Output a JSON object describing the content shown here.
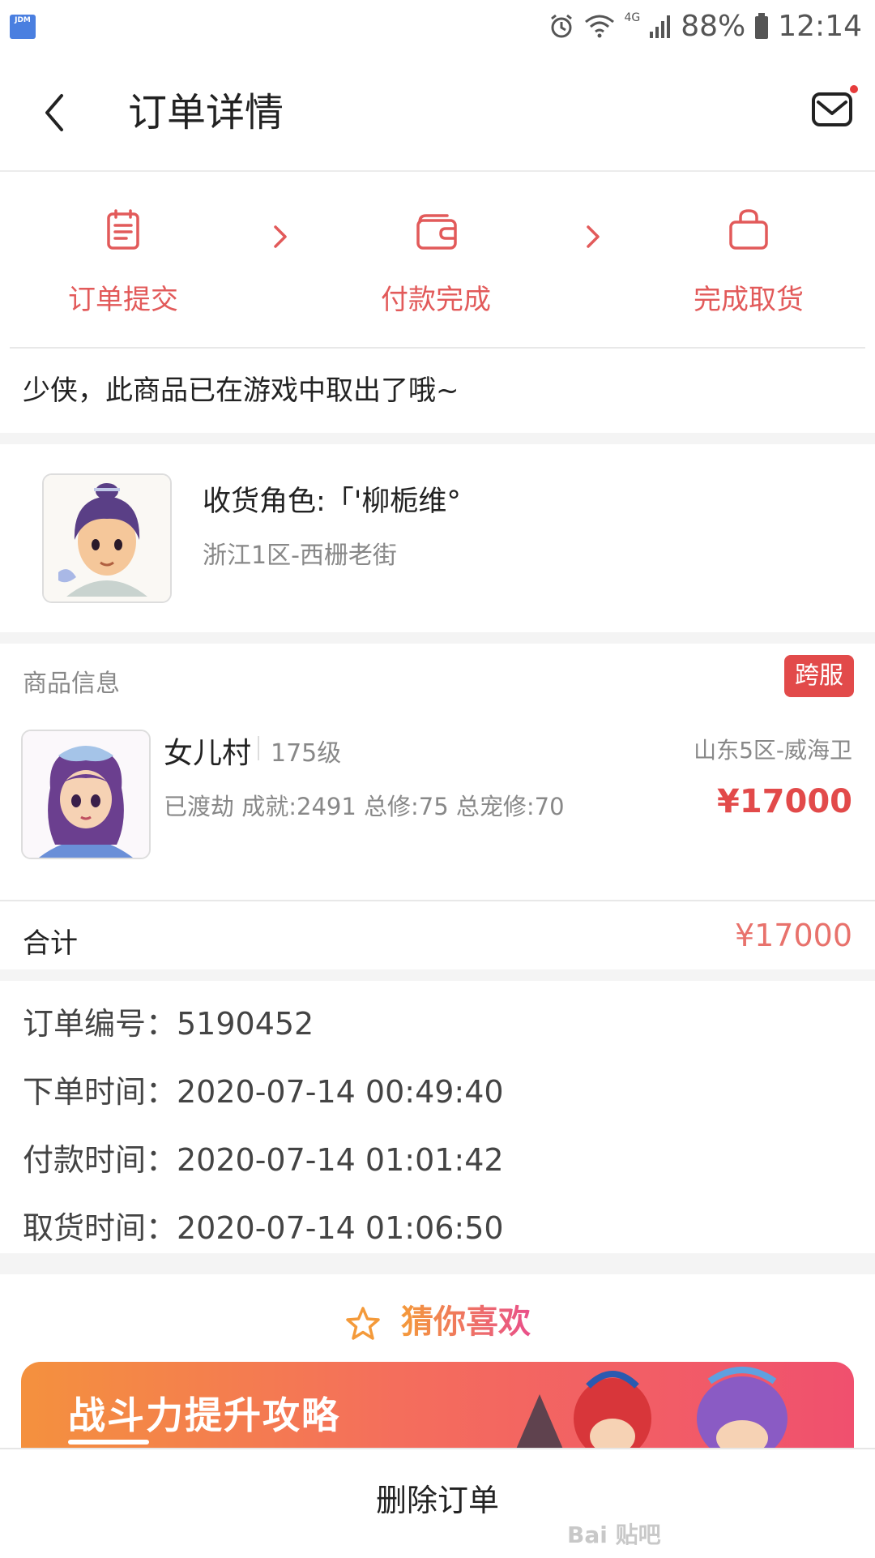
{
  "status_bar": {
    "app_icon": "JDM",
    "battery": "88%",
    "time": "12:14",
    "network": "4G"
  },
  "header": {
    "title": "订单详情"
  },
  "steps": [
    {
      "label": "订单提交",
      "icon": "order-list-icon"
    },
    {
      "label": "付款完成",
      "icon": "wallet-icon"
    },
    {
      "label": "完成取货",
      "icon": "bag-icon"
    }
  ],
  "notice": "少侠，此商品已在游戏中取出了哦~",
  "receiver": {
    "name_line": "收货角色:「'柳栀维°",
    "server": "浙江1区-西栅老街"
  },
  "goods": {
    "section_label": "商品信息",
    "badge": "跨服",
    "name": "女儿村",
    "level": "175级",
    "server": "山东5区-威海卫",
    "attrs": "已渡劫 成就:2491 总修:75 总宠修:70",
    "price": "¥17000"
  },
  "total": {
    "label": "合计",
    "value": "¥17000"
  },
  "order_info": [
    "订单编号：5190452",
    "下单时间：2020-07-14 00:49:40",
    "付款时间：2020-07-14 01:01:42",
    "取货时间：2020-07-14 01:06:50"
  ],
  "recommend": {
    "title": "猜你喜欢",
    "banner_title": "战斗力提升攻略"
  },
  "bottom": {
    "delete_label": "删除订单"
  },
  "watermark": "Bai 贴吧",
  "colors": {
    "accent": "#e24a4a",
    "step": "#e25a5a",
    "total": "#e8726c"
  }
}
